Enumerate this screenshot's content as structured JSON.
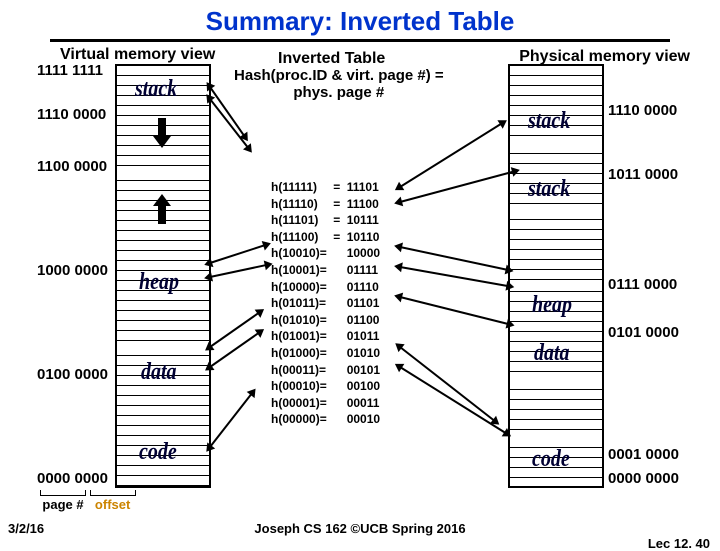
{
  "title": "Summary: Inverted Table",
  "headers": {
    "vm": "Virtual memory view",
    "pm": "Physical memory view",
    "iv": "Inverted Table",
    "hash": "Hash(proc.ID & virt. page #) =\nphys. page #"
  },
  "vm": {
    "addrs": {
      "a0": "1111 1111",
      "a1": "1110 0000",
      "a2": "1100 0000",
      "a3": "1000 0000",
      "a4": "0100 0000",
      "a5": "0000 0000"
    },
    "labels": {
      "stack": "stack",
      "heap": "heap",
      "data": "data",
      "code": "code"
    }
  },
  "pm": {
    "addrs": {
      "b0": "1110 0000",
      "b1": "1011 0000",
      "b2": "0111 0000",
      "b3": "0101 0000",
      "b4": "0001 0000",
      "b5": "0000 0000"
    },
    "labels": {
      "stack": "stack",
      "stack2": "stack",
      "heap": "heap",
      "data": "data",
      "code": "code"
    }
  },
  "hash": [
    [
      "h(11111)",
      "11101"
    ],
    [
      "h(11110)",
      "11100"
    ],
    [
      "h(11101)",
      "10111"
    ],
    [
      "h(11100)",
      "10110"
    ],
    [
      "h(10010)=",
      "10000"
    ],
    [
      "h(10001)=",
      "01111"
    ],
    [
      "h(10000)=",
      "01110"
    ],
    [
      "h(01011)=",
      "01101"
    ],
    [
      "h(01010)=",
      "01100"
    ],
    [
      "h(01001)=",
      "01011"
    ],
    [
      "h(01000)=",
      "01010"
    ],
    [
      "h(00011)=",
      "00101"
    ],
    [
      "h(00010)=",
      "00100"
    ],
    [
      "h(00001)=",
      "00011"
    ],
    [
      "h(00000)=",
      "00010"
    ]
  ],
  "hash_eq_first4": "=",
  "page_offset": {
    "page": "page #",
    "offset": "offset"
  },
  "footer": {
    "date": "3/2/16",
    "mid": "Joseph CS 162 ©UCB Spring 2016",
    "lec": "Lec 12. 40"
  }
}
